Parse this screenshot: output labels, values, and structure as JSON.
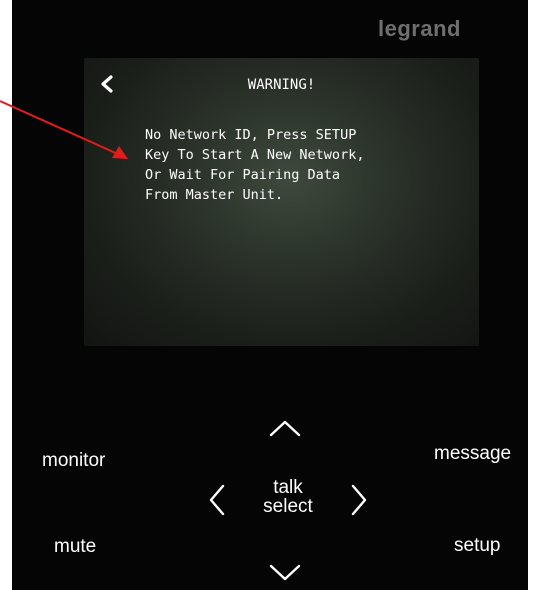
{
  "brand": {
    "name": "legrand"
  },
  "screen": {
    "title": "WARNING!",
    "message": "No Network ID, Press SETUP\nKey To Start A New Network,\nOr Wait For Pairing Data\nFrom Master Unit.",
    "back_icon": "chevron-left-icon"
  },
  "controls": {
    "monitor_label": "monitor",
    "mute_label": "mute",
    "message_label": "message",
    "setup_label": "setup",
    "talk_label": "talk",
    "select_label": "select",
    "nav_icons": {
      "up": "chevron-up-icon",
      "down": "chevron-down-icon",
      "left": "chevron-left-icon",
      "right": "chevron-right-icon"
    }
  },
  "colors": {
    "panel_background": "#050505",
    "screen_glow": "#3e4a3c",
    "brand_text": "#6f6f6f",
    "text": "#ffffff",
    "annotation_arrow": "#e31b1b"
  }
}
